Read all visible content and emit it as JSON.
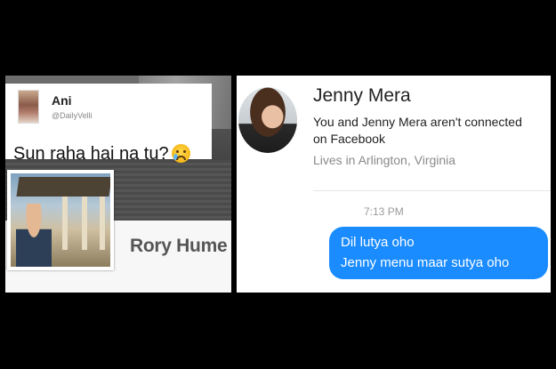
{
  "tweet": {
    "name": "Ani",
    "handle": "@DailyVelli",
    "text": "Sun raha hai na tu?",
    "emoji_icon": "crying-face-emoji"
  },
  "facebook_profile": {
    "name": "Rory Hume"
  },
  "messenger": {
    "contact_name": "Jenny Mera",
    "connection_line1": "You and Jenny Mera aren't connected",
    "connection_line2": "on Facebook",
    "location": "Lives in Arlington, Virginia",
    "timestamp": "7:13 PM",
    "message_line1": "Dil lutya oho",
    "message_line2": "Jenny menu maar sutya oho",
    "bubble_color": "#1a8cff"
  }
}
